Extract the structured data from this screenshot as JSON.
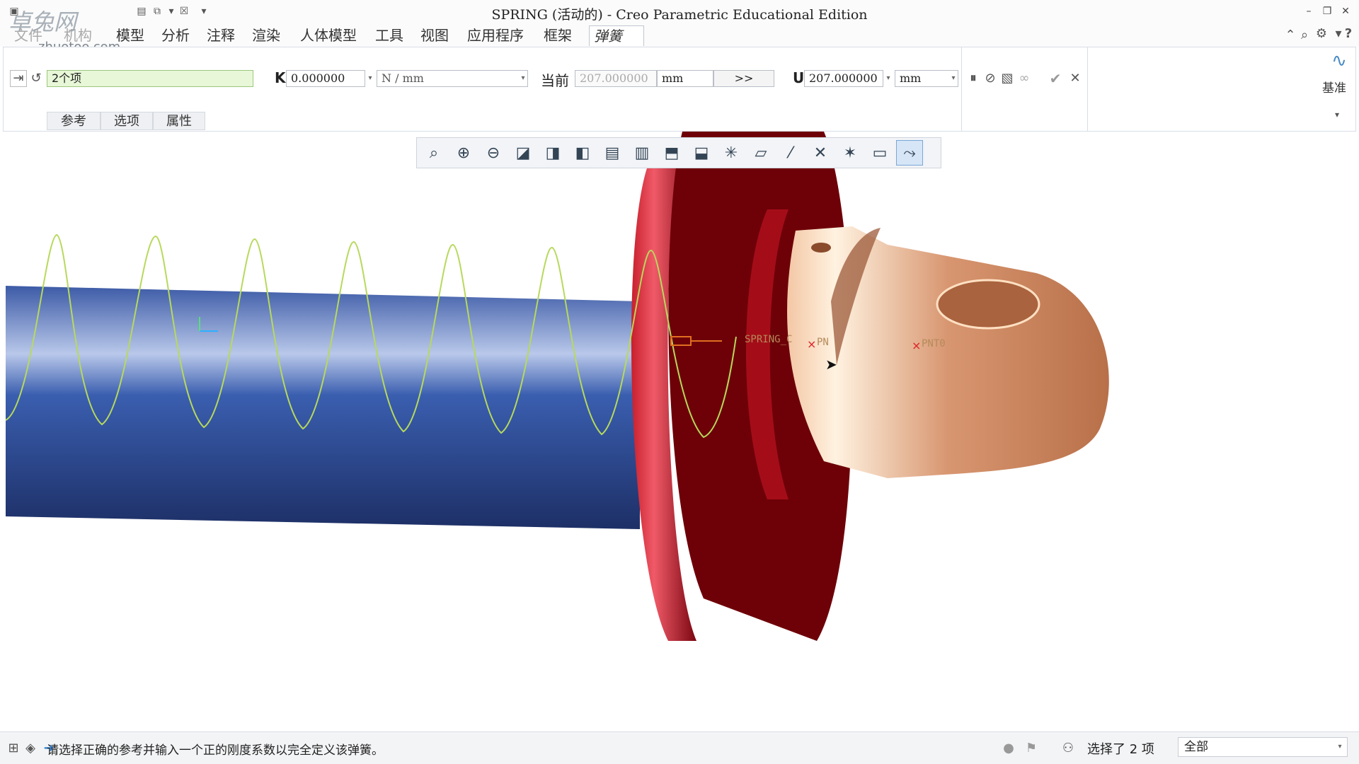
{
  "window": {
    "title": "SPRING (活动的) - Creo Parametric Educational Edition",
    "watermark": "卓兔网",
    "watermark_url": "zhuotoo.com",
    "controls": [
      "minimize-icon",
      "restore-icon",
      "close-icon"
    ]
  },
  "menu": {
    "tabs": [
      "文件",
      "机构",
      "模型",
      "分析",
      "注释",
      "渲染",
      "人体模型",
      "工具",
      "视图",
      "应用程序",
      "框架",
      "弹簧"
    ],
    "active": "弹簧"
  },
  "ribbon": {
    "reference_value": "2个项",
    "k_label": "K",
    "k_value": "0.000000",
    "k_unit": "N / mm",
    "current_label": "当前",
    "current_value": "207.000000",
    "current_unit": "mm",
    "more_label": ">>",
    "u_label": "U",
    "u_value": "207.000000",
    "u_unit": "mm",
    "datum_label": "基准",
    "subtabs": [
      "参考",
      "选项",
      "属性"
    ]
  },
  "view_toolbar": {
    "icons": [
      "refit-icon",
      "zoom-in-icon",
      "zoom-out-icon",
      "repaint-icon",
      "shaded-edges-icon",
      "shaded-icon",
      "saved-views-icon",
      "view-manager-icon",
      "display-style-icon",
      "orient-icon",
      "plane-display-icon",
      "axis-display-icon",
      "point-display-icon",
      "csys-display-icon",
      "annotation-display-icon",
      "spin-center-icon",
      "mechanism-display-icon"
    ],
    "active_index": 16
  },
  "viewport": {
    "labels": [
      "SPRING_C",
      "PN",
      "PNT0"
    ],
    "colors": {
      "rod": "#2e4a92",
      "flange": "#8f0a14",
      "eye": "#d28e65",
      "spring": "#b7d95c"
    }
  },
  "status": {
    "message": "请选择正确的参考并输入一个正的刚度系数以完全定义该弹簧。",
    "selection": "选择了 2 项",
    "filter": "全部"
  }
}
